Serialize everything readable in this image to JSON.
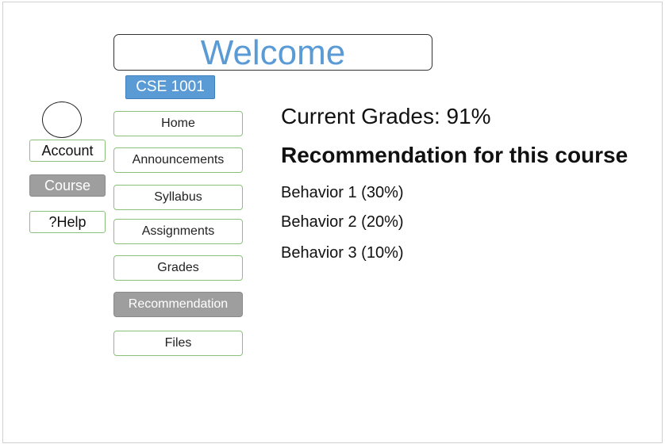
{
  "header": {
    "title": "Welcome",
    "course_code": "CSE 1001"
  },
  "side_menu": {
    "avatar_icon": "user-avatar-circle",
    "account_label": "Account",
    "course_label": "Course",
    "help_label": "?Help"
  },
  "nav": {
    "items": [
      {
        "label": "Home"
      },
      {
        "label": "Announcements"
      },
      {
        "label": "Syllabus"
      },
      {
        "label": "Assignments"
      },
      {
        "label": "Grades"
      },
      {
        "label": "Recommendation"
      },
      {
        "label": "Files"
      }
    ],
    "active": "Recommendation"
  },
  "main": {
    "current_grades": "Current Grades: 91%",
    "recommendation_title": "Recommendation for this course",
    "behaviors": [
      "Behavior 1 (30%)",
      "Behavior 2 (20%)",
      "Behavior 3 (10%)"
    ]
  },
  "colors": {
    "accent_blue": "#5b9bd5",
    "button_border_green": "#8cc07a",
    "active_gray": "#9e9e9e"
  }
}
